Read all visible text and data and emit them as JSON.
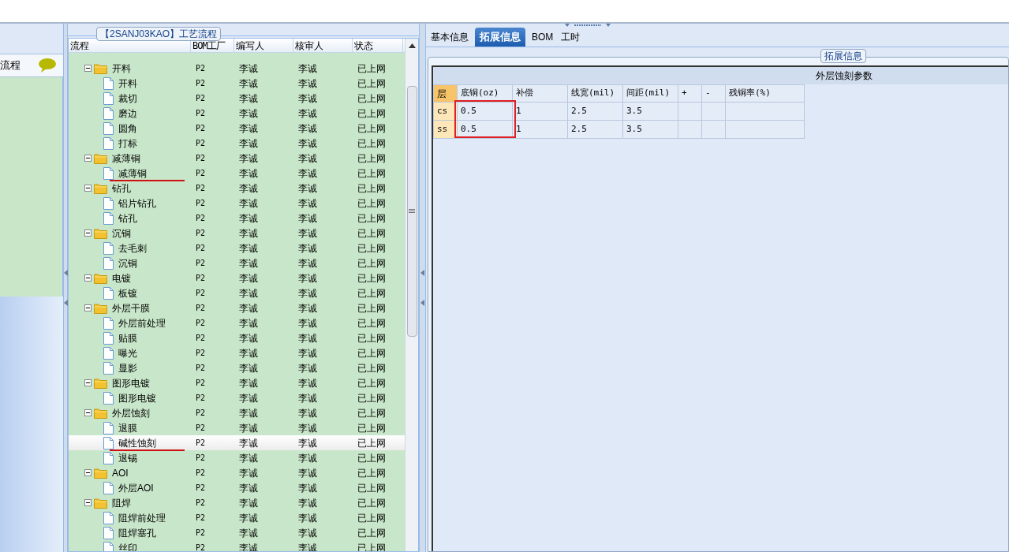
{
  "left_panel": {
    "title": "流程"
  },
  "process_panel": {
    "title": "【2SANJ03KAO】工艺流程",
    "columns": [
      "流程",
      "BOM工厂",
      "编写人",
      "核审人",
      "状态"
    ],
    "tree": [
      {
        "label": "开料",
        "kind": "folder",
        "expanded": true,
        "selected": false,
        "cells": [
          "P2",
          "李诚",
          "李诚",
          "已上网"
        ],
        "children": [
          {
            "label": "开料",
            "kind": "file",
            "selected": false,
            "cells": [
              "P2",
              "李诚",
              "李诚",
              "已上网"
            ]
          },
          {
            "label": "裁切",
            "kind": "file",
            "selected": false,
            "cells": [
              "P2",
              "李诚",
              "李诚",
              "已上网"
            ]
          },
          {
            "label": "磨边",
            "kind": "file",
            "selected": false,
            "cells": [
              "P2",
              "李诚",
              "李诚",
              "已上网"
            ]
          },
          {
            "label": "圆角",
            "kind": "file",
            "selected": false,
            "cells": [
              "P2",
              "李诚",
              "李诚",
              "已上网"
            ]
          },
          {
            "label": "打标",
            "kind": "file",
            "selected": false,
            "cells": [
              "P2",
              "李诚",
              "李诚",
              "已上网"
            ]
          }
        ]
      },
      {
        "label": "减薄铜",
        "kind": "folder",
        "expanded": true,
        "selected": false,
        "cells": [
          "P2",
          "李诚",
          "李诚",
          "已上网"
        ],
        "children": [
          {
            "label": "减薄铜",
            "kind": "file",
            "selected": false,
            "underlined": true,
            "cells": [
              "P2",
              "李诚",
              "李诚",
              "已上网"
            ]
          }
        ]
      },
      {
        "label": "钻孔",
        "kind": "folder",
        "expanded": true,
        "selected": false,
        "cells": [
          "P2",
          "李诚",
          "李诚",
          "已上网"
        ],
        "children": [
          {
            "label": "铝片钻孔",
            "kind": "file",
            "selected": false,
            "cells": [
              "P2",
              "李诚",
              "李诚",
              "已上网"
            ]
          },
          {
            "label": "钻孔",
            "kind": "file",
            "selected": false,
            "cells": [
              "P2",
              "李诚",
              "李诚",
              "已上网"
            ]
          }
        ]
      },
      {
        "label": "沉铜",
        "kind": "folder",
        "expanded": true,
        "selected": false,
        "cells": [
          "P2",
          "李诚",
          "李诚",
          "已上网"
        ],
        "children": [
          {
            "label": "去毛刺",
            "kind": "file",
            "selected": false,
            "cells": [
              "P2",
              "李诚",
              "李诚",
              "已上网"
            ]
          },
          {
            "label": "沉铜",
            "kind": "file",
            "selected": false,
            "cells": [
              "P2",
              "李诚",
              "李诚",
              "已上网"
            ]
          }
        ]
      },
      {
        "label": "电镀",
        "kind": "folder",
        "expanded": true,
        "selected": false,
        "cells": [
          "P2",
          "李诚",
          "李诚",
          "已上网"
        ],
        "children": [
          {
            "label": "板镀",
            "kind": "file",
            "selected": false,
            "cells": [
              "P2",
              "李诚",
              "李诚",
              "已上网"
            ]
          }
        ]
      },
      {
        "label": "外层干膜",
        "kind": "folder",
        "expanded": true,
        "selected": false,
        "cells": [
          "P2",
          "李诚",
          "李诚",
          "已上网"
        ],
        "children": [
          {
            "label": "外层前处理",
            "kind": "file",
            "selected": false,
            "cells": [
              "P2",
              "李诚",
              "李诚",
              "已上网"
            ]
          },
          {
            "label": "贴膜",
            "kind": "file",
            "selected": false,
            "cells": [
              "P2",
              "李诚",
              "李诚",
              "已上网"
            ]
          },
          {
            "label": "曝光",
            "kind": "file",
            "selected": false,
            "cells": [
              "P2",
              "李诚",
              "李诚",
              "已上网"
            ]
          },
          {
            "label": "显影",
            "kind": "file",
            "selected": false,
            "cells": [
              "P2",
              "李诚",
              "李诚",
              "已上网"
            ]
          }
        ]
      },
      {
        "label": "图形电镀",
        "kind": "folder",
        "expanded": true,
        "selected": false,
        "cells": [
          "P2",
          "李诚",
          "李诚",
          "已上网"
        ],
        "children": [
          {
            "label": "图形电镀",
            "kind": "file",
            "selected": false,
            "cells": [
              "P2",
              "李诚",
              "李诚",
              "已上网"
            ]
          }
        ]
      },
      {
        "label": "外层蚀刻",
        "kind": "folder",
        "expanded": true,
        "selected": false,
        "cells": [
          "P2",
          "李诚",
          "李诚",
          "已上网"
        ],
        "children": [
          {
            "label": "退膜",
            "kind": "file",
            "selected": false,
            "cells": [
              "P2",
              "李诚",
              "李诚",
              "已上网"
            ]
          },
          {
            "label": "碱性蚀刻",
            "kind": "file",
            "selected": true,
            "underlined": true,
            "cells": [
              "P2",
              "李诚",
              "李诚",
              "已上网"
            ]
          },
          {
            "label": "退锡",
            "kind": "file",
            "selected": false,
            "cells": [
              "P2",
              "李诚",
              "李诚",
              "已上网"
            ]
          }
        ]
      },
      {
        "label": "AOI",
        "kind": "folder",
        "expanded": true,
        "selected": false,
        "cells": [
          "P2",
          "李诚",
          "李诚",
          "已上网"
        ],
        "children": [
          {
            "label": "外层AOI",
            "kind": "file",
            "selected": false,
            "cells": [
              "P2",
              "李诚",
              "李诚",
              "已上网"
            ]
          }
        ]
      },
      {
        "label": "阻焊",
        "kind": "folder",
        "expanded": true,
        "selected": false,
        "cells": [
          "P2",
          "李诚",
          "李诚",
          "已上网"
        ],
        "children": [
          {
            "label": "阻焊前处理",
            "kind": "file",
            "selected": false,
            "cells": [
              "P2",
              "李诚",
              "李诚",
              "已上网"
            ]
          },
          {
            "label": "阻焊塞孔",
            "kind": "file",
            "selected": false,
            "cells": [
              "P2",
              "李诚",
              "李诚",
              "已上网"
            ]
          },
          {
            "label": "丝印",
            "kind": "file",
            "selected": false,
            "cells": [
              "P2",
              "李诚",
              "李诚",
              "已上网"
            ]
          }
        ]
      }
    ]
  },
  "detail_panel": {
    "tabs": [
      {
        "label": "基本信息",
        "selected": false
      },
      {
        "label": "拓展信息",
        "selected": true
      },
      {
        "label": "BOM",
        "selected": false
      },
      {
        "label": "工时",
        "selected": false
      }
    ],
    "group_title": "拓展信息",
    "section_title": "外层蚀刻参数",
    "table": {
      "columns": [
        "层",
        "底铜(oz)",
        "补偿",
        "线宽(mil)",
        "间距(mil)",
        "+",
        "-",
        "残铜率(%)"
      ],
      "rows": [
        [
          "cs",
          "0.5",
          "1",
          "2.5",
          "3.5",
          "",
          "",
          " "
        ],
        [
          "ss",
          "0.5",
          "1",
          "2.5",
          "3.5",
          "",
          "",
          " "
        ]
      ]
    }
  }
}
